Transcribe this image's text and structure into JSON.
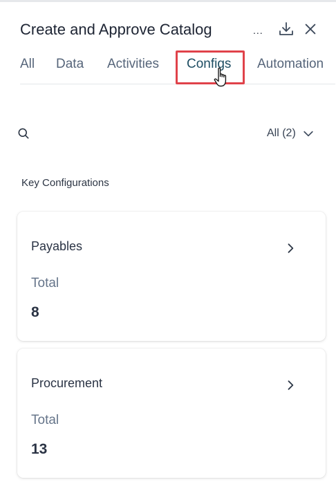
{
  "header": {
    "title": "Create and Approve Catalog",
    "ellipsis": "...",
    "icons": {
      "download": "download-icon",
      "close": "close-icon"
    }
  },
  "tabs": [
    {
      "label": "All"
    },
    {
      "label": "Data"
    },
    {
      "label": "Activities"
    },
    {
      "label": "Configs",
      "active": true
    },
    {
      "label": "Automation"
    }
  ],
  "toolbar": {
    "search_icon": "search-icon",
    "filter_label": "All (2)"
  },
  "section": {
    "title": "Key Configurations"
  },
  "cards": [
    {
      "name": "Payables",
      "total_label": "Total",
      "total_value": "8"
    },
    {
      "name": "Procurement",
      "total_label": "Total",
      "total_value": "13"
    }
  ],
  "colors": {
    "active_tab_text": "#1e4e63",
    "active_tab_underline": "#1e3d55",
    "highlight_border": "#e0424a"
  }
}
